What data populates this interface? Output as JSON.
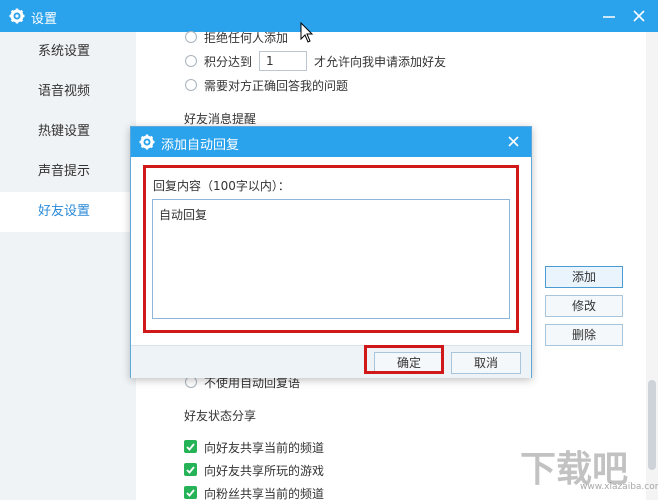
{
  "window": {
    "title": "设置"
  },
  "sidebar": {
    "items": [
      {
        "label": "系统设置"
      },
      {
        "label": "语音视频"
      },
      {
        "label": "热键设置"
      },
      {
        "label": "声音提示"
      },
      {
        "label": "好友设置"
      }
    ],
    "active_index": 4
  },
  "friend_request": {
    "options": [
      {
        "label": "拒绝任何人添加"
      },
      {
        "label_before": "积分达到",
        "value": "1",
        "label_after": "才允许向我申请添加好友"
      },
      {
        "label": "需要对方正确回答我的问题"
      }
    ]
  },
  "message_reminder": {
    "title": "好友消息提醒"
  },
  "auto_reply": {
    "side_buttons": {
      "add": "添加",
      "edit": "修改",
      "delete": "删除"
    },
    "no_auto_reply_label": "不使用自动回复语"
  },
  "status_share": {
    "title": "好友状态分享",
    "items": [
      {
        "label": "向好友共享当前的频道",
        "checked": true
      },
      {
        "label": "向好友共享所玩的游戏",
        "checked": true
      },
      {
        "label": "向粉丝共享当前的频道",
        "checked": true
      }
    ]
  },
  "dialog": {
    "title": "添加自动回复",
    "content_label": "回复内容（100字以内）：",
    "content_value": "自动回复",
    "confirm_label": "确定",
    "cancel_label": "取消"
  },
  "watermark": {
    "text": "下载吧",
    "sub": "www.xiazaiba.com"
  },
  "colors": {
    "titlebar": "#2aa2ec",
    "highlight": "#d01818",
    "checkbox": "#26b256",
    "active_nav": "#2a8ad8"
  }
}
